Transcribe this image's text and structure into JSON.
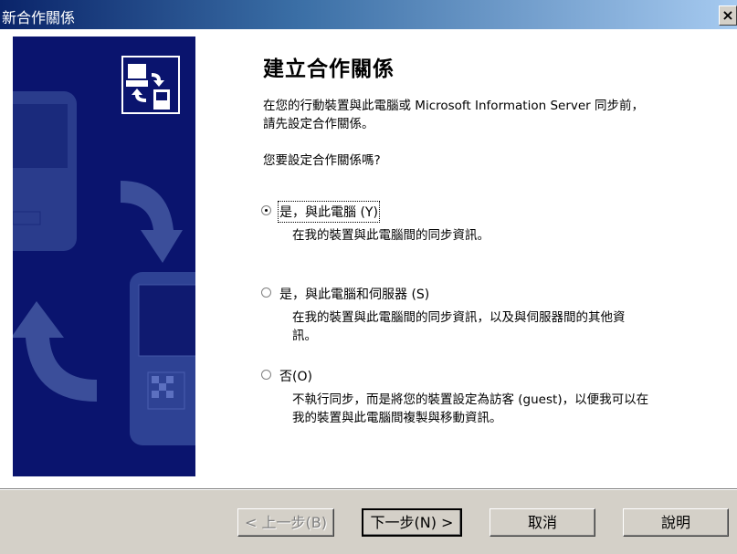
{
  "window": {
    "title": "新合作關係",
    "close_icon": "×"
  },
  "main": {
    "heading": "建立合作關係",
    "intro_line1": "在您的行動裝置與此電腦或 Microsoft Information Server 同步前，",
    "intro_line2": "請先設定合作關係。",
    "question": "您要設定合作關係嗎?",
    "options": [
      {
        "label": "是，與此電腦 (Y)",
        "description": "在我的裝置與此電腦間的同步資訊。",
        "selected": true
      },
      {
        "label": "是，與此電腦和伺服器 (S)",
        "description_line1": "在我的裝置與此電腦間的同步資訊，以及與伺服器間的其他資",
        "description_line2": "訊。",
        "selected": false
      },
      {
        "label": "否(O)",
        "description_line1": "不執行同步，而是將您的裝置設定為訪客 (guest)，以便我可以在",
        "description_line2": "我的裝置與此電腦間複製與移動資訊。",
        "selected": false
      }
    ]
  },
  "buttons": {
    "back": "< 上一步(B)",
    "next": "下一步(N) >",
    "cancel": "取消",
    "help": "說明"
  },
  "colors": {
    "banner": "#0a146e",
    "titlebar_start": "#0a246a",
    "titlebar_end": "#a6caf0",
    "dialog": "#d4d0c8"
  }
}
